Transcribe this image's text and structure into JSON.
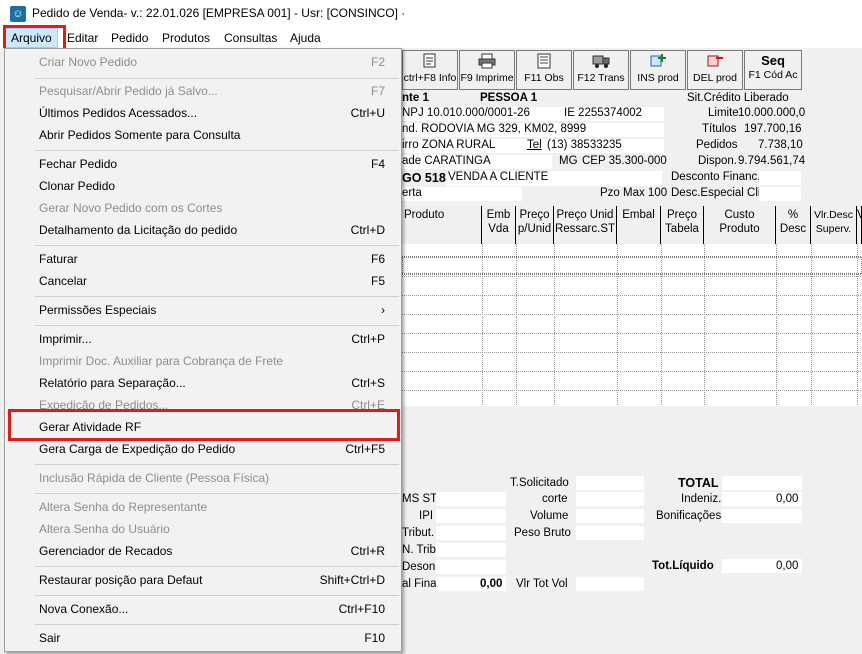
{
  "window": {
    "title": "Pedido de Venda- v.: 22.01.026  [EMPRESA 001] - Usr: [CONSINCO] ·"
  },
  "menubar": [
    "Arquivo",
    "Editar",
    "Pedido",
    "Produtos",
    "Consultas",
    "Ajuda"
  ],
  "toolbar": [
    {
      "label": "ctrl+F8 Info",
      "icon": "info-icon"
    },
    {
      "label": "F9 Imprime",
      "icon": "printer-icon"
    },
    {
      "label": "F11 Obs",
      "icon": "note-icon"
    },
    {
      "label": "F12 Trans",
      "icon": "truck-icon"
    },
    {
      "label": "INS prod",
      "icon": "insert-product-icon"
    },
    {
      "label": "DEL prod",
      "icon": "delete-product-icon"
    },
    {
      "label": "F1 Cód Ac",
      "title": "Seq"
    }
  ],
  "menu": {
    "items": [
      {
        "label": "Criar Novo Pedido",
        "shortcut": "F2",
        "disabled": true
      },
      {
        "label": "Pesquisar/Abrir Pedido já Salvo...",
        "shortcut": "F7",
        "disabled": true
      },
      {
        "label": "Últimos Pedidos Acessados...",
        "shortcut": "Ctrl+U",
        "disabled": false
      },
      {
        "label": "Abrir Pedidos Somente para Consulta",
        "shortcut": "",
        "disabled": false
      },
      {
        "label": "Fechar Pedido",
        "shortcut": "F4",
        "disabled": false
      },
      {
        "label": "Clonar Pedido",
        "shortcut": "",
        "disabled": false
      },
      {
        "label": "Gerar Novo Pedido com os Cortes",
        "shortcut": "",
        "disabled": true
      },
      {
        "label": "Detalhamento da Licitação  do pedido",
        "shortcut": "Ctrl+D",
        "disabled": false
      },
      {
        "label": "Faturar",
        "shortcut": "F6",
        "disabled": false
      },
      {
        "label": "Cancelar",
        "shortcut": "F5",
        "disabled": false
      },
      {
        "label": "Permissões Especiais",
        "shortcut": "›",
        "disabled": false
      },
      {
        "label": "Imprimir...",
        "shortcut": "Ctrl+P",
        "disabled": false
      },
      {
        "label": "Imprimir Doc. Auxiliar para Cobrança de Frete",
        "shortcut": "",
        "disabled": true
      },
      {
        "label": "Relatório para Separação...",
        "shortcut": "Ctrl+S",
        "disabled": false
      },
      {
        "label": "Expedição de Pedidos...",
        "shortcut": "Ctrl+E",
        "disabled": true
      },
      {
        "label": "Gerar Atividade RF",
        "shortcut": "",
        "disabled": false
      },
      {
        "label": "Gera Carga de Expedição do Pedido",
        "shortcut": "Ctrl+F5",
        "disabled": false
      },
      {
        "label": "Inclusão Rápida de Cliente (Pessoa Física)",
        "shortcut": "",
        "disabled": true
      },
      {
        "label": "Altera Senha do Representante",
        "shortcut": "",
        "disabled": true
      },
      {
        "label": "Altera Senha do Usuário",
        "shortcut": "",
        "disabled": true
      },
      {
        "label": "Gerenciador de Recados",
        "shortcut": "Ctrl+R",
        "disabled": false
      },
      {
        "label": "Restaurar posição para Defaut",
        "shortcut": "Shift+Ctrl+D",
        "disabled": false
      },
      {
        "label": "Nova Conexão...",
        "shortcut": "Ctrl+F10",
        "disabled": false
      },
      {
        "label": "Sair",
        "shortcut": "F10",
        "disabled": false
      }
    ]
  },
  "header": {
    "cliente": "nte 1",
    "cliente_nome": "PESSOA 1",
    "cnpj": "NPJ 10.010.000/0001-26",
    "ie": "IE 2255374002",
    "endereco": "nd. RODOVIA MG 329, KM02, 8999",
    "bairro": "irro ZONA RURAL",
    "tel_label": "Tel",
    "tel": "(13) 38533235",
    "cidade": "ade CARATINGA",
    "uf": "MG",
    "cep": "CEP   35.300-000",
    "operacao": "GO 518",
    "operacao_desc": "VENDA A CLIENTE",
    "aberta": "erta",
    "pzo_max": "Pzo Max 100",
    "credito": "Sit.Crédito Liberado",
    "limite_label": "Limite",
    "limite": "10.000.000,0",
    "titulos_label": "Títulos",
    "titulos": "197.700,16",
    "pedidos_label": "Pedidos",
    "pedidos": "7.738,10",
    "dispon_label": "Dispon.",
    "dispon": "9.794.561,74",
    "desc_financ": "Desconto Financ.",
    "desc_especial": "Desc.Especial Cli."
  },
  "grid": {
    "columns": [
      "Produto",
      "Emb\nVda",
      "Preço\np/Unid",
      "Preço Unid\nRessarc.ST",
      "Embal",
      "Preço\nTabela",
      "Custo\nProduto",
      "%\nDesc",
      "Vlr.Desc\nSuperv.",
      "V"
    ]
  },
  "totals": {
    "ms_st": "MS ST",
    "ipi": "IPI",
    "tribut": "Tribut.",
    "n_trib": "N. Trib.",
    "deson": "Deson.",
    "final": "al Final",
    "final_value": "0,00",
    "t_solicitado": "T.Solicitado",
    "corte": "corte",
    "volume": "Volume",
    "peso_bruto": "Peso Bruto",
    "vlr_tot_vol": "Vlr Tot Vol",
    "total": "TOTAL",
    "indeniz": "Indeniz.",
    "indeniz_value": "0,00",
    "bonificacoes": "Bonificações",
    "tot_liquido": "Tot.Líquido",
    "tot_liquido_value": "0,00"
  }
}
